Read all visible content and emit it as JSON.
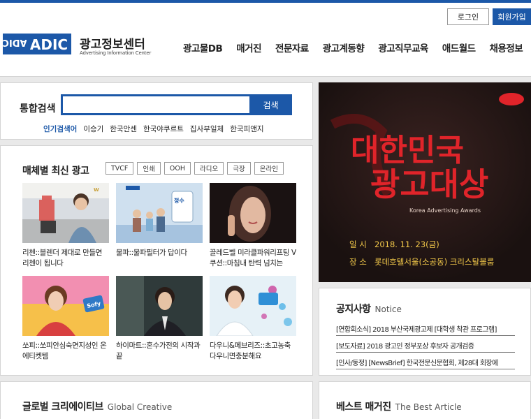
{
  "header": {
    "login_label": "로그인",
    "join_label": "회원가입",
    "logo_mark_text": "ADIC",
    "logo_title": "광고정보센터",
    "logo_subtitle": "Advertising Information Center",
    "nav": [
      "광고물DB",
      "매거진",
      "전문자료",
      "광고계동향",
      "광고직무교육",
      "애드월드",
      "채용정보"
    ]
  },
  "search": {
    "label": "통합검색",
    "value": "",
    "placeholder": "",
    "button_label": "검색",
    "popular_title": "인기검색어",
    "popular_terms": [
      "이승기",
      "한국안센",
      "한국야쿠르트",
      "집사부일체",
      "한국피앤지"
    ]
  },
  "media": {
    "title": "매체별 최신 광고",
    "filters": [
      "TVCF",
      "인쇄",
      "OOH",
      "라디오",
      "극장",
      "온라인"
    ],
    "items": [
      {
        "caption": "리첸::블렌더 제대로 만들면 리첸이 됩니다"
      },
      {
        "caption": "물파::물파필터가 답이다"
      },
      {
        "caption": "끌레드벨 미라클파워리프팅 V쿠션::마침내 탄력 넘치는"
      },
      {
        "caption": "쏘피::쏘피안심숙면지성인 온에티켓템"
      },
      {
        "caption": "하이마트::혼수가전의 시작과 끝"
      },
      {
        "caption": "다우니&페브리즈::초고농축 다우니면충분해요"
      }
    ]
  },
  "banner": {
    "title_line1": "대한민국",
    "title_line2": "광고대상",
    "subtitle": "Korea Advertising Awards",
    "date_label": "일 시",
    "date_value": "2018. 11. 23(금)",
    "place_label": "장 소",
    "place_value": "롯데호텔서울(소공동) 크리스탈볼룸",
    "colors": {
      "accent": "#e0242a",
      "gold": "#f3c94a",
      "bg": "#1c1413"
    }
  },
  "notice": {
    "title": "공지사항",
    "title_en": "Notice",
    "items": [
      "[연합회소식] 2018 부산국제광고제 [대학생 착관 프로그램]",
      "[보도자료] 2018 광고인 정부포상 후보자 공개검증",
      "[인사/동정] [NewsBrief] 한국전문신문협회, 제28대 회장에"
    ]
  },
  "global": {
    "title": "글로벌 크리에이티브",
    "title_en": "Global Creative"
  },
  "best": {
    "title": "베스트 매거진",
    "title_en": "The Best Article"
  },
  "colors": {
    "brand": "#1c58a8",
    "background": "#e9e9e9"
  }
}
